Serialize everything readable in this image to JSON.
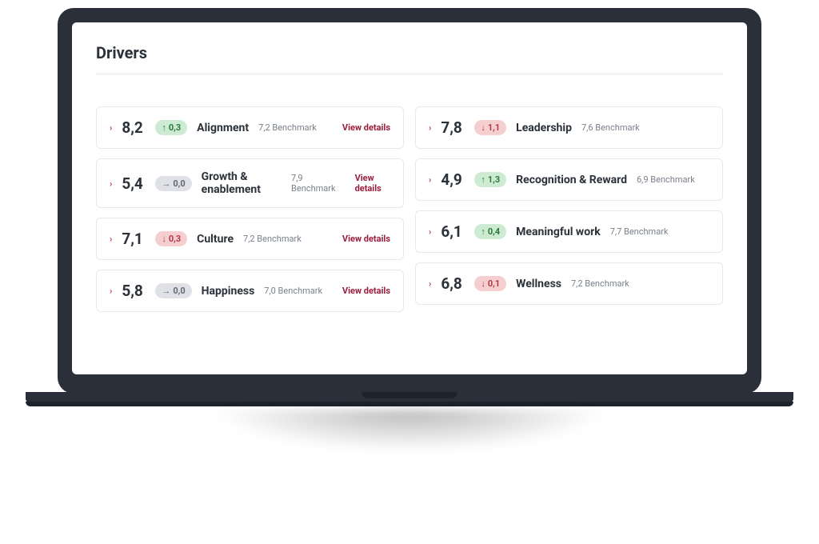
{
  "page": {
    "title": "Drivers"
  },
  "labels": {
    "viewDetails": "View details",
    "benchmarkWord": "Benchmark"
  },
  "leftColumn": [
    {
      "score": "8,2",
      "trend": "up",
      "delta": "0,3",
      "name": "Alignment",
      "benchmark": "7,2"
    },
    {
      "score": "5,4",
      "trend": "flat",
      "delta": "0,0",
      "name": "Growth & enablement",
      "benchmark": "7,9"
    },
    {
      "score": "7,1",
      "trend": "down",
      "delta": "0,3",
      "name": "Culture",
      "benchmark": "7,2"
    },
    {
      "score": "5,8",
      "trend": "flat",
      "delta": "0,0",
      "name": "Happiness",
      "benchmark": "7,0"
    }
  ],
  "rightColumn": [
    {
      "score": "7,8",
      "trend": "down",
      "delta": "1,1",
      "name": "Leadership",
      "benchmark": "7,6"
    },
    {
      "score": "4,9",
      "trend": "up",
      "delta": "1,3",
      "name": "Recognition & Reward",
      "benchmark": "6,9"
    },
    {
      "score": "6,1",
      "trend": "up",
      "delta": "0,4",
      "name": "Meaningful work",
      "benchmark": "7,7"
    },
    {
      "score": "6,8",
      "trend": "down",
      "delta": "0,1",
      "name": "Wellness",
      "benchmark": "7,2"
    }
  ]
}
